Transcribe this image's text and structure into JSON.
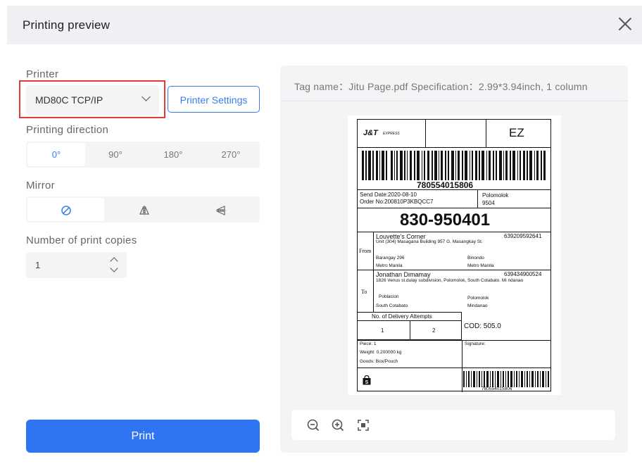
{
  "dialog": {
    "title": "Printing preview"
  },
  "printer": {
    "label": "Printer",
    "selected": "MD80C TCP/IP",
    "settings_button": "Printer Settings"
  },
  "direction": {
    "label": "Printing direction",
    "options": [
      "0°",
      "90°",
      "180°",
      "270°"
    ],
    "selected_index": 0
  },
  "mirror": {
    "label": "Mirror",
    "options": [
      "none-icon",
      "mirror-horizontal-icon",
      "mirror-vertical-icon"
    ],
    "selected_index": 0
  },
  "copies": {
    "label": "Number of print copies",
    "value": "1"
  },
  "print_button": "Print",
  "preview": {
    "info": "Tag name：Jitu Page.pdf  Specification：2.99*3.94inch,  1 column",
    "toolbar": [
      "zoom-out-icon",
      "zoom-in-icon",
      "fit-screen-icon"
    ]
  },
  "label": {
    "brand": "J&T",
    "brand_sub": "EXPRESS",
    "code": "EZ",
    "barcode_number": "780554015806",
    "send_date": "Send Date:2020-08-10",
    "order_no": "Order No:200810P3KBQCC7",
    "dest_city": "Polomolok",
    "dest_zip": "9504",
    "sort_code": "830-950401",
    "from_label": "From",
    "from_name": "Louvette's Corner",
    "from_phone": "639209592641",
    "from_address": "Unit (304) Masagana Building 957 G. Masangkay St.",
    "from_barangay": "Barangay 296",
    "from_city": "Binondo",
    "from_region1": "Metro Manila",
    "from_region2": "Metro Manila",
    "to_label": "To",
    "to_name": "Jonathan Dimamay",
    "to_phone": "639434900524",
    "to_address": "1826 Venus st.dulay subdivision, Polomolok, South Cotabato. Mi ndanao",
    "to_barangay": "Poblacion",
    "to_city": "Polomolok",
    "to_province": "South Cotabato",
    "to_region": "Mindanao",
    "attempts_label": "No. of Delivery Attempts",
    "attempt_1": "1",
    "attempt_2": "2",
    "cod": "COD: 505.0",
    "piece": "Piece: 1",
    "weight": "Weight:  0.200000 kg",
    "goods": "Goods: Box/Pouch",
    "signature": "Signature:",
    "small_barcode_number": "780554015806"
  }
}
